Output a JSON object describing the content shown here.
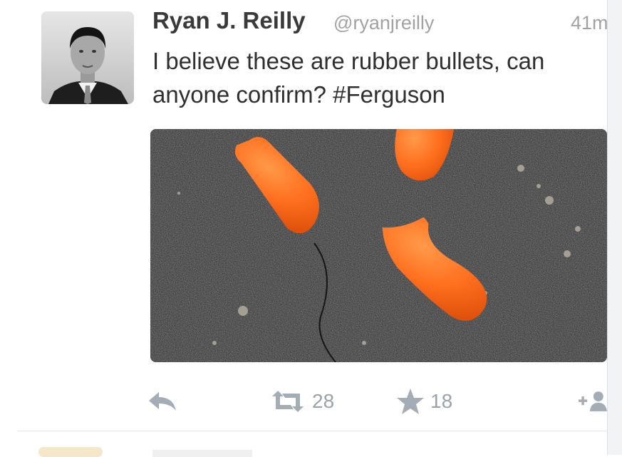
{
  "tweet": {
    "author_name": "Ryan J. Reilly",
    "handle": "@ryanjreilly",
    "time": "41m",
    "text": "I believe these are rubber bullets, can anyone confirm? #Ferguson",
    "retweet_count": "28",
    "favorite_count": "18"
  },
  "icons": {
    "reply": "reply-icon",
    "retweet": "retweet-icon",
    "favorite": "star-icon",
    "follow": "follow-icon"
  },
  "colors": {
    "action_gray": "#9aa3ab",
    "name_text": "#3a3a3a",
    "meta_gray": "#a2a2a2",
    "earplug_orange": "#ff6f1e"
  }
}
